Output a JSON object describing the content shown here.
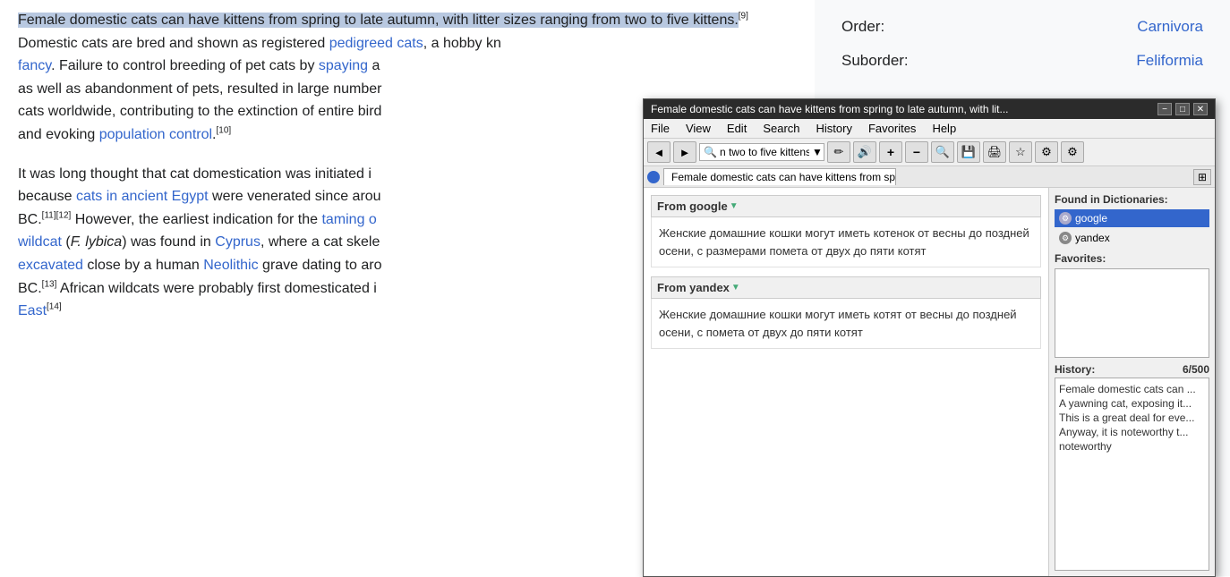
{
  "wiki": {
    "paragraphs": [
      {
        "id": "p1",
        "parts": [
          {
            "type": "highlight",
            "text": "Female domestic cats can have kittens from spring to late autumn, with litter sizes ranging from two to five kittens."
          },
          {
            "type": "sup",
            "text": "[9]"
          },
          {
            "type": "text",
            "text": " Domestic cats are bred and shown as registered "
          },
          {
            "type": "link",
            "text": "pedigreed cats"
          },
          {
            "type": "text",
            "text": ", a hobby kn"
          },
          {
            "type": "linebreak"
          },
          {
            "type": "link",
            "text": "fancy"
          },
          {
            "type": "text",
            "text": ". Failure to control breeding of pet cats by "
          },
          {
            "type": "link",
            "text": "spaying"
          },
          {
            "type": "text",
            "text": " a"
          },
          {
            "type": "linebreak"
          },
          {
            "type": "text",
            "text": "as well as abandonment of pets, resulted in large number"
          },
          {
            "type": "linebreak"
          },
          {
            "type": "text",
            "text": "cats worldwide, contributing to the extinction of entire bird"
          },
          {
            "type": "linebreak"
          },
          {
            "type": "text",
            "text": "and evoking "
          },
          {
            "type": "link",
            "text": "population control"
          },
          {
            "type": "sup",
            "text": "[10]"
          },
          {
            "type": "text",
            "text": "."
          }
        ]
      },
      {
        "id": "p2",
        "parts": [
          {
            "type": "text",
            "text": "It was long thought that cat domestication was initiated i"
          },
          {
            "type": "linebreak"
          },
          {
            "type": "text",
            "text": "because "
          },
          {
            "type": "link",
            "text": "cats in ancient Egypt"
          },
          {
            "type": "text",
            "text": " were venerated since arou"
          },
          {
            "type": "linebreak"
          },
          {
            "type": "text",
            "text": "BC."
          },
          {
            "type": "sup",
            "text": "[11]"
          },
          {
            "type": "sup",
            "text": "[12]"
          },
          {
            "type": "text",
            "text": " However, the earliest indication for the "
          },
          {
            "type": "link",
            "text": "taming o"
          },
          {
            "type": "linebreak"
          },
          {
            "type": "link",
            "text": "wildcat"
          },
          {
            "type": "text",
            "text": " ("
          },
          {
            "type": "italic",
            "text": "F. lybica"
          },
          {
            "type": "text",
            "text": ") was found in "
          },
          {
            "type": "link",
            "text": "Cyprus"
          },
          {
            "type": "text",
            "text": ", where a cat skele"
          },
          {
            "type": "linebreak"
          },
          {
            "type": "link",
            "text": "excavated"
          },
          {
            "type": "text",
            "text": " close by a human "
          },
          {
            "type": "link",
            "text": "Neolithic"
          },
          {
            "type": "text",
            "text": " grave dating to aro"
          },
          {
            "type": "linebreak"
          },
          {
            "type": "text",
            "text": "BC."
          },
          {
            "type": "sup",
            "text": "[13]"
          },
          {
            "type": "text",
            "text": " African wildcats were probably first domesticated i"
          },
          {
            "type": "linebreak"
          },
          {
            "type": "link",
            "text": "East"
          },
          {
            "type": "sup",
            "text": "[14]"
          }
        ]
      }
    ]
  },
  "taxonomy": {
    "rows": [
      {
        "label": "Order:",
        "value": "Carnivora"
      },
      {
        "label": "Suborder:",
        "value": "Feliformia"
      }
    ]
  },
  "popup": {
    "titlebar": {
      "title": "Female domestic cats can have kittens from spring to late autumn, with lit...",
      "minimize": "−",
      "restore": "□",
      "close": "✕"
    },
    "menubar": [
      "File",
      "View",
      "Edit",
      "Search",
      "History",
      "Favorites",
      "Help"
    ],
    "toolbar": {
      "back": "◄",
      "forward": "►",
      "search_text": "n two to five kittens",
      "pencil": "✏",
      "speaker": "🔊",
      "zoom_in": "+",
      "zoom_out": "−",
      "find": "🔍",
      "save": "💾",
      "print": "🖨",
      "star": "☆",
      "settings": "⚙",
      "settings2": "⚙"
    },
    "tab": {
      "title": "Female domestic cats can have kittens from spri...",
      "close": "✕"
    },
    "found_in_title": "Found in Dictionaries:",
    "dictionaries": [
      {
        "name": "google",
        "selected": true
      },
      {
        "name": "yandex",
        "selected": false
      }
    ],
    "translations": [
      {
        "source": "From google",
        "text": "Женские домашние кошки могут иметь котенок от весны до поздней осени, с размерами помета от двух до пяти котят"
      },
      {
        "source": "From yandex",
        "text": "Женские домашние кошки могут иметь котят от весны до поздней осени, с помета от двух до пяти котят"
      }
    ],
    "favorites_label": "Favorites:",
    "history_label": "History:",
    "history_count": "6/500",
    "history_items": [
      "Female domestic cats can ...",
      "A yawning cat, exposing it...",
      "This is a great deal for eve...",
      "Anyway, it is noteworthy t...",
      "noteworthy"
    ]
  }
}
